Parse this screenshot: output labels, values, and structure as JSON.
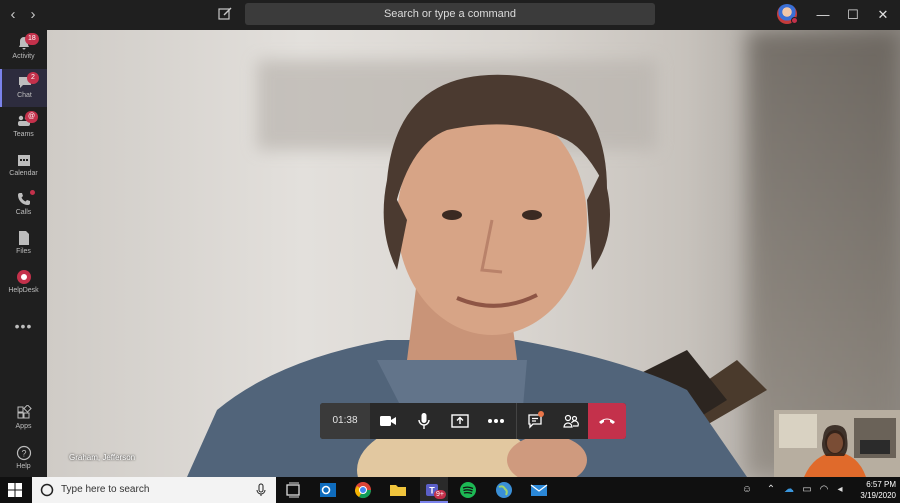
{
  "titlebar": {
    "search_placeholder": "Search or type a command",
    "back_icon": "chevron-left-icon",
    "forward_icon": "chevron-right-icon",
    "minimize": "—",
    "maximize": "☐",
    "close": "✕"
  },
  "rail": {
    "items": [
      {
        "label": "Activity",
        "icon": "bell-icon",
        "badge": "18"
      },
      {
        "label": "Chat",
        "icon": "chat-icon",
        "badge": "2",
        "active": true
      },
      {
        "label": "Teams",
        "icon": "teams-icon",
        "badge": "@"
      },
      {
        "label": "Calendar",
        "icon": "calendar-icon"
      },
      {
        "label": "Calls",
        "icon": "phone-icon",
        "dot": true
      },
      {
        "label": "Files",
        "icon": "file-icon"
      },
      {
        "label": "HelpDesk",
        "icon": "helpdesk-icon"
      },
      {
        "label": "Apps",
        "icon": "apps-icon"
      },
      {
        "label": "Help",
        "icon": "help-icon"
      }
    ],
    "more": "•••"
  },
  "call": {
    "caller_name": "Graham, Jefferson",
    "timer": "01:38"
  },
  "taskbar": {
    "search_placeholder": "Type here to search",
    "time": "6:57 PM",
    "date": "3/19/2020",
    "teams_badge": "9+"
  },
  "colors": {
    "accent": "#7b83eb",
    "hangup": "#c4314b",
    "badge": "#c4314b"
  }
}
